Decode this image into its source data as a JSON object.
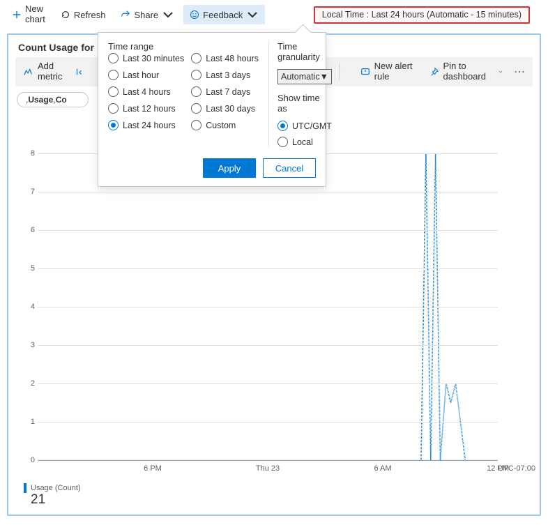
{
  "toolbar": {
    "newchart_line1": "New",
    "newchart_line2": "chart",
    "refresh": "Refresh",
    "share": "Share",
    "feedback": "Feedback"
  },
  "time_pill": {
    "text": "Local Time : Last 24 hours (Automatic - 15 minutes)"
  },
  "panel": {
    "title": "Count Usage for"
  },
  "metricbar": {
    "add_line1": "Add",
    "add_line2": "metric",
    "new_alert_line1": "New alert",
    "new_alert_line2": "rule",
    "pin_line1": "Pin to",
    "pin_line2": "dashboard"
  },
  "chip": {
    "prefix": ", ",
    "b1": "Usage",
    "sep": ", ",
    "b2": "Co"
  },
  "legend": {
    "series_label": "Usage (Count)",
    "value": "21"
  },
  "popover": {
    "time_range_label": "Time range",
    "granularity_label": "Time granularity",
    "granularity_value": "Automatic",
    "show_time_label": "Show time as",
    "apply": "Apply",
    "cancel": "Cancel",
    "ranges_colA": [
      "Last 30 minutes",
      "Last hour",
      "Last 4 hours",
      "Last 12 hours",
      "Last 24 hours"
    ],
    "ranges_colB": [
      "Last 48 hours",
      "Last 3 days",
      "Last 7 days",
      "Last 30 days",
      "Custom"
    ],
    "selected_range": "Last 24 hours",
    "show_time_options": [
      "UTC/GMT",
      "Local"
    ],
    "selected_show_time": "UTC/GMT"
  },
  "chart_data": {
    "type": "line",
    "ylabel": "",
    "xlabel": "",
    "ylim": [
      0,
      8
    ],
    "y_ticks": [
      0,
      1,
      2,
      3,
      4,
      5,
      6,
      7,
      8
    ],
    "x_ticks": [
      "6 PM",
      "Thu 23",
      "6 AM",
      "12 PM"
    ],
    "timezone": "UTC-07:00",
    "x_hours_since_start": [
      20.0,
      20.25,
      20.5,
      20.75,
      21.0,
      21.15,
      21.3,
      21.55,
      21.8,
      22.05,
      22.3
    ],
    "series": [
      {
        "name": "Usage (Count)",
        "values": [
          0,
          8.6,
          0,
          8.6,
          0,
          1,
          2,
          1.5,
          2,
          1,
          0
        ],
        "color": "#0078d4",
        "style": "dotted"
      }
    ],
    "legend_value_displayed": 21
  }
}
